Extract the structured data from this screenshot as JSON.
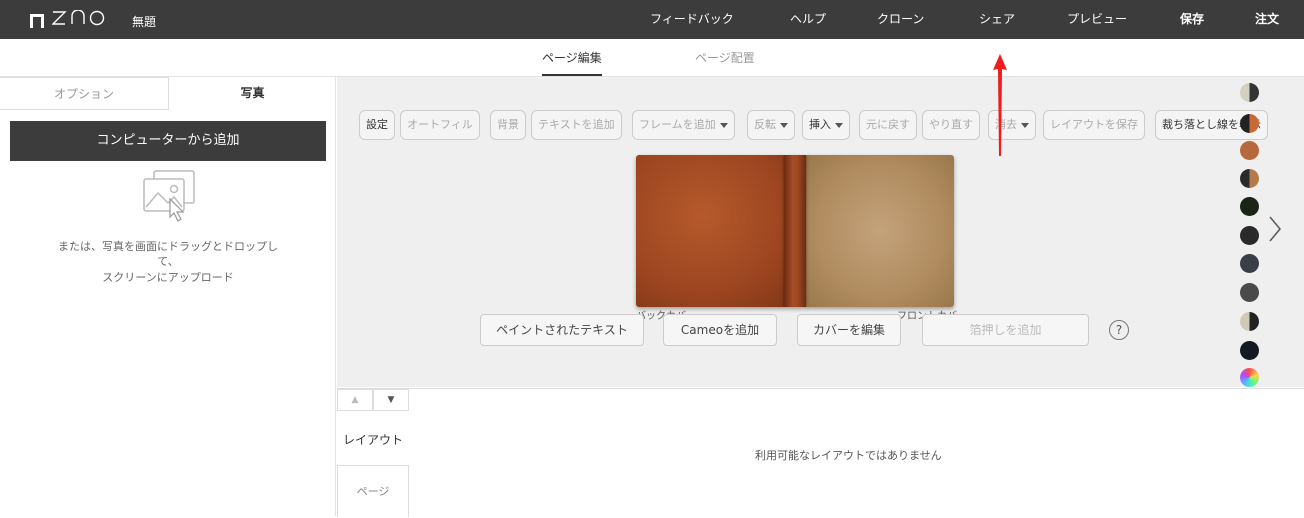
{
  "header": {
    "brand": "ZNO",
    "title": "無題",
    "nav": [
      "フィードバック",
      "ヘルプ",
      "クローン",
      "シェア",
      "プレビュー",
      "保存",
      "注文"
    ]
  },
  "subtabs": [
    "ページ編集",
    "ページ配置"
  ],
  "left_panel": {
    "tabs": [
      "オプション",
      "写真"
    ],
    "add_button": "コンピューターから追加",
    "drop_text_1": "または、写真を画面にドラッグとドロップし",
    "drop_text_2": "て、",
    "drop_text_3": "スクリーンにアップロード"
  },
  "toolbar": [
    "設定",
    "オートフィル",
    "背景",
    "テキストを追加",
    "フレームを追加",
    "反転",
    "挿入",
    "元に戻す",
    "やり直す",
    "消去",
    "レイアウトを保存",
    "裁ち落とし線を表示"
  ],
  "book_labels": {
    "back": "バックカバー",
    "front": "フロントカバー"
  },
  "actions": [
    "ペイントされたテキスト",
    "Cameoを追加",
    "カバーを編集",
    "箔押しを追加"
  ],
  "help_label": "?",
  "swatches": [
    "#d4d0c0|#333333",
    "#222222|#c86a35",
    "#b5693c",
    "#2a2a2a|#b57a4a",
    "#1c2418",
    "#2a2a2a",
    "#3a3f47",
    "#4a4a4a",
    "#cfcab8|#222222",
    "#151a22",
    "#multicolor"
  ],
  "bottom": {
    "layout_label": "レイアウト",
    "page_tab": "ページ",
    "no_layout": "利用可能なレイアウトではありません"
  }
}
